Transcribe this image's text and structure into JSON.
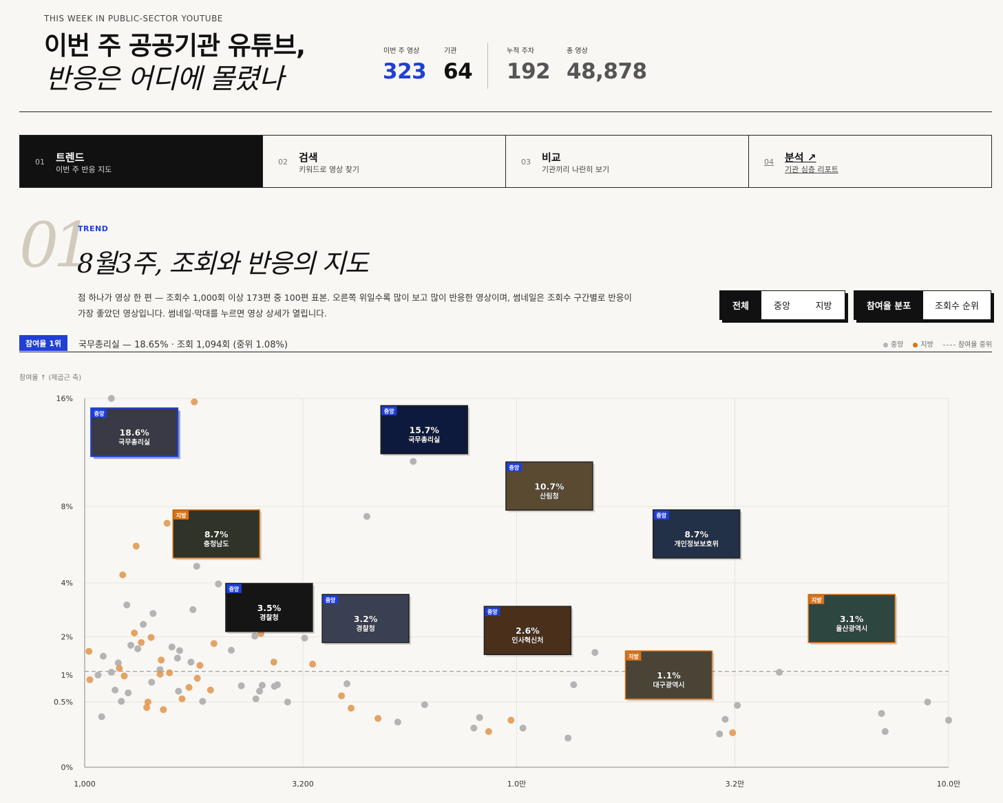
{
  "header": {
    "eyebrow": "THIS WEEK IN PUBLIC-SECTOR YOUTUBE",
    "title_line1": "이번 주 공공기관 유튜브,",
    "title_line2": "반응은 어디에 몰렸나"
  },
  "stats": [
    {
      "label": "이번 주 영상",
      "value": "323",
      "color": "#1f3fd6"
    },
    {
      "label": "기관",
      "value": "64",
      "color": "#111111"
    },
    {
      "label": "누적 주차",
      "value": "192",
      "color": "#555555"
    },
    {
      "label": "총 영상",
      "value": "48,878",
      "color": "#555555"
    }
  ],
  "tabs": [
    {
      "num": "01",
      "name": "트렌드",
      "desc": "이번 주 반응 지도",
      "active": true
    },
    {
      "num": "02",
      "name": "검색",
      "desc": "키워드로 영상 찾기",
      "active": false
    },
    {
      "num": "03",
      "name": "비교",
      "desc": "기관끼리 나란히 보기",
      "active": false
    },
    {
      "num": "04",
      "name": "분석 ↗",
      "desc": "기관 심층 리포트",
      "active": false
    }
  ],
  "section": {
    "num": "01",
    "kicker": "TREND",
    "title": "8월3주, 조회와 반응의 지도",
    "description": "점 하나가 영상 한 편 — 조회수 1,000회 이상 173편 중 100편 표본. 오른쪽 위일수록 많이 보고 많이 반응한 영상이며, 썸네일은 조회수 구간별로 반응이 가장 좋았던 영상입니다. 썸네일·막대를 누르면 영상 상세가 열립니다."
  },
  "filters": {
    "scope": [
      "전체",
      "중앙",
      "지방"
    ],
    "scope_selected": "전체",
    "view": [
      "참여율 분포",
      "조회수 순위"
    ],
    "view_selected": "참여율 분포"
  },
  "top_badge": "참여율 1위",
  "top_text": "국무총리실 — 18.65% · 조회 1,094회 (중위 1.08%)",
  "legend": {
    "central": "중앙",
    "local": "지방",
    "median": "참여율 중위"
  },
  "colors": {
    "central": "#b4b4b4",
    "local": "#e0944a",
    "accent": "#1f3fd6",
    "central_tag": "#1f3fd6",
    "local_tag": "#d9731a"
  },
  "chart_data": {
    "type": "scatter",
    "ylabel": "참여율 ↑ (제곱근 축)",
    "x_scale": "log",
    "y_scale": "sqrt",
    "xlim": [
      1000,
      100000
    ],
    "ylim": [
      0,
      16
    ],
    "x_ticks": [
      {
        "v": 1000,
        "label": "1,000"
      },
      {
        "v": 3200,
        "label": "3,200"
      },
      {
        "v": 10000,
        "label": "1.0만"
      },
      {
        "v": 32000,
        "label": "3.2만"
      },
      {
        "v": 100000,
        "label": "10.0만"
      }
    ],
    "y_ticks": [
      {
        "v": 0,
        "label": "0%"
      },
      {
        "v": 0.5,
        "label": "0.5%"
      },
      {
        "v": 1,
        "label": "1%"
      },
      {
        "v": 2,
        "label": "2%"
      },
      {
        "v": 4,
        "label": "4%"
      },
      {
        "v": 8,
        "label": "8%"
      },
      {
        "v": 16,
        "label": "16%"
      }
    ],
    "median": 1.08,
    "points": [
      {
        "x": 1153,
        "y": 16
      },
      {
        "x": 1161,
        "y": 14.9
      },
      {
        "x": 1794,
        "y": 15.7
      },
      {
        "x": 1095,
        "y": 0.3
      },
      {
        "x": 1023,
        "y": 1.58
      },
      {
        "x": 1104,
        "y": 1.45
      },
      {
        "x": 1028,
        "y": 0.9
      },
      {
        "x": 1074,
        "y": 1.0
      },
      {
        "x": 1153,
        "y": 1.06
      },
      {
        "x": 1176,
        "y": 0.7
      },
      {
        "x": 1216,
        "y": 0.51
      },
      {
        "x": 1196,
        "y": 1.28
      },
      {
        "x": 1203,
        "y": 1.15
      },
      {
        "x": 1235,
        "y": 0.98
      },
      {
        "x": 1252,
        "y": 3.1
      },
      {
        "x": 1327,
        "y": 1.65
      },
      {
        "x": 1352,
        "y": 1.83
      },
      {
        "x": 1367,
        "y": 2.4
      },
      {
        "x": 1303,
        "y": 2.12
      },
      {
        "x": 1279,
        "y": 1.75
      },
      {
        "x": 1261,
        "y": 0.65
      },
      {
        "x": 1392,
        "y": 0.42
      },
      {
        "x": 1401,
        "y": 0.5
      },
      {
        "x": 1225,
        "y": 4.35
      },
      {
        "x": 1316,
        "y": 5.75
      },
      {
        "x": 1440,
        "y": 2.78
      },
      {
        "x": 1425,
        "y": 1.98
      },
      {
        "x": 1494,
        "y": 1.12
      },
      {
        "x": 1504,
        "y": 1.35
      },
      {
        "x": 1495,
        "y": 1.02
      },
      {
        "x": 1429,
        "y": 0.85
      },
      {
        "x": 1521,
        "y": 0.39
      },
      {
        "x": 1552,
        "y": 7.0
      },
      {
        "x": 1572,
        "y": 1.05
      },
      {
        "x": 1640,
        "y": 1.4
      },
      {
        "x": 1592,
        "y": 1.7
      },
      {
        "x": 1659,
        "y": 1.6
      },
      {
        "x": 1680,
        "y": 0.55
      },
      {
        "x": 1649,
        "y": 0.68
      },
      {
        "x": 1744,
        "y": 0.75
      },
      {
        "x": 1762,
        "y": 1.3
      },
      {
        "x": 1781,
        "y": 2.92
      },
      {
        "x": 1817,
        "y": 4.75
      },
      {
        "x": 1848,
        "y": 1.22
      },
      {
        "x": 1823,
        "y": 0.93
      },
      {
        "x": 1875,
        "y": 0.51
      },
      {
        "x": 1956,
        "y": 0.7
      },
      {
        "x": 1992,
        "y": 1.8
      },
      {
        "x": 2040,
        "y": 3.95
      },
      {
        "x": 2185,
        "y": 1.61
      },
      {
        "x": 2204,
        "y": 2.6
      },
      {
        "x": 2170,
        "y": 2.54
      },
      {
        "x": 2305,
        "y": 0.78
      },
      {
        "x": 2389,
        "y": 2.45
      },
      {
        "x": 2476,
        "y": 2.02
      },
      {
        "x": 2558,
        "y": 2.1
      },
      {
        "x": 2491,
        "y": 0.55
      },
      {
        "x": 2540,
        "y": 0.68
      },
      {
        "x": 2576,
        "y": 0.79
      },
      {
        "x": 2741,
        "y": 1.3
      },
      {
        "x": 2750,
        "y": 0.77
      },
      {
        "x": 2794,
        "y": 0.8
      },
      {
        "x": 2870,
        "y": 2.5
      },
      {
        "x": 2950,
        "y": 0.5
      },
      {
        "x": 3230,
        "y": 1.96
      },
      {
        "x": 3370,
        "y": 1.25
      },
      {
        "x": 3815,
        "y": 2.05
      },
      {
        "x": 3932,
        "y": 0.6
      },
      {
        "x": 4047,
        "y": 0.82
      },
      {
        "x": 4137,
        "y": 0.41
      },
      {
        "x": 4345,
        "y": 2.0
      },
      {
        "x": 4500,
        "y": 7.4
      },
      {
        "x": 4612,
        "y": 2.3
      },
      {
        "x": 4776,
        "y": 0.28
      },
      {
        "x": 5307,
        "y": 0.24
      },
      {
        "x": 5762,
        "y": 11.0
      },
      {
        "x": 6124,
        "y": 0.46
      },
      {
        "x": 7960,
        "y": 0.18
      },
      {
        "x": 8205,
        "y": 0.29
      },
      {
        "x": 8614,
        "y": 0.15
      },
      {
        "x": 9702,
        "y": 0.26
      },
      {
        "x": 10341,
        "y": 0.18
      },
      {
        "x": 13150,
        "y": 0.1
      },
      {
        "x": 13550,
        "y": 0.8
      },
      {
        "x": 15180,
        "y": 1.55
      },
      {
        "x": 30390,
        "y": 0.27
      },
      {
        "x": 29490,
        "y": 0.13
      },
      {
        "x": 31620,
        "y": 0.14
      },
      {
        "x": 32430,
        "y": 0.45
      },
      {
        "x": 40560,
        "y": 1.06
      },
      {
        "x": 69950,
        "y": 0.34
      },
      {
        "x": 71290,
        "y": 0.15
      },
      {
        "x": 89410,
        "y": 0.5
      },
      {
        "x": 100000,
        "y": 0.26
      }
    ],
    "local_points": [
      1,
      2,
      4,
      6,
      12,
      13,
      16,
      18,
      21,
      22,
      23,
      24,
      26,
      28,
      29,
      31,
      32,
      33,
      37,
      39,
      43,
      44,
      46,
      47,
      51,
      55,
      59,
      65,
      67,
      69,
      73,
      79,
      80,
      87,
      98
    ],
    "featured": [
      {
        "x": 1303,
        "y": 13.2,
        "tag": "중앙",
        "pct": "18.6%",
        "org": "국무총리실",
        "bg": "#3a3a46",
        "selected": true
      },
      {
        "x": 2017,
        "y": 6.4,
        "tag": "지방",
        "pct": "8.7%",
        "org": "충청남도",
        "bg": "#2f3328"
      },
      {
        "x": 2673,
        "y": 3.0,
        "tag": "중앙",
        "pct": "3.5%",
        "org": "경찰청",
        "bg": "#151515"
      },
      {
        "x": 4470,
        "y": 2.6,
        "tag": "중앙",
        "pct": "3.2%",
        "org": "경찰청",
        "bg": "#3a3f52"
      },
      {
        "x": 6110,
        "y": 13.4,
        "tag": "중앙",
        "pct": "15.7%",
        "org": "국무총리실",
        "bg": "#0e1a3d"
      },
      {
        "x": 10600,
        "y": 2.2,
        "tag": "중앙",
        "pct": "2.6%",
        "org": "인사혁신처",
        "bg": "#4a2f1a"
      },
      {
        "x": 11900,
        "y": 9.3,
        "tag": "중앙",
        "pct": "10.7%",
        "org": "산림청",
        "bg": "#5a4a32"
      },
      {
        "x": 22500,
        "y": 1.0,
        "tag": "지방",
        "pct": "1.1%",
        "org": "대구광역시",
        "bg": "#4a4436"
      },
      {
        "x": 26080,
        "y": 6.4,
        "tag": "중앙",
        "pct": "8.7%",
        "org": "개인정보보호위",
        "bg": "#223048"
      },
      {
        "x": 59650,
        "y": 2.6,
        "tag": "지방",
        "pct": "3.1%",
        "org": "울산광역시",
        "bg": "#2e4640"
      }
    ]
  }
}
